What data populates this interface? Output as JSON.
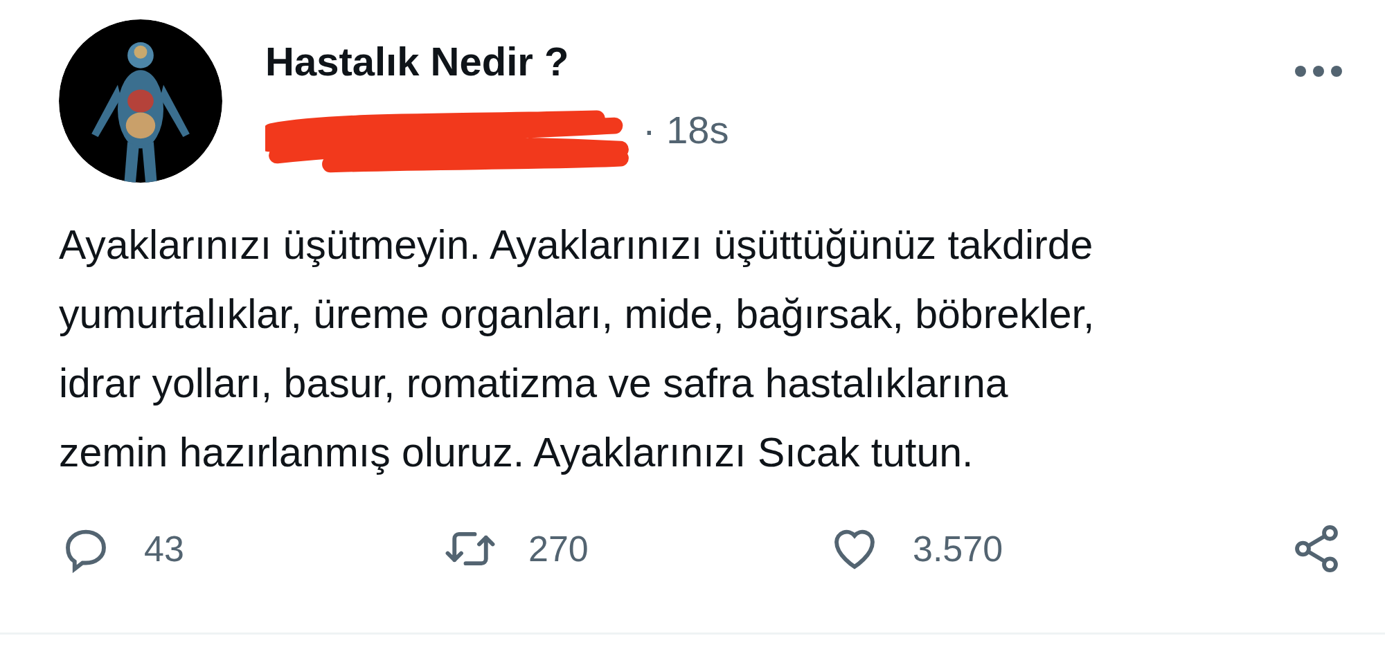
{
  "tweet": {
    "author_name": "Hastalık Nedir ?",
    "time": "· 18s",
    "body_lines": [
      "Ayaklarınızı üşütmeyin. Ayaklarınızı üşüttüğünüz takdirde",
      "yumurtalıklar, üreme organları, mide, bağırsak, böbrekler,",
      "idrar yolları, basur, romatizma ve safra hastalıklarına",
      "zemin hazırlanmış oluruz. Ayaklarınızı Sıcak tutun."
    ],
    "actions": [
      {
        "kind": "reply",
        "count": "43"
      },
      {
        "kind": "retweet",
        "count": "270"
      },
      {
        "kind": "like",
        "count": "3.570"
      },
      {
        "kind": "share"
      }
    ]
  }
}
